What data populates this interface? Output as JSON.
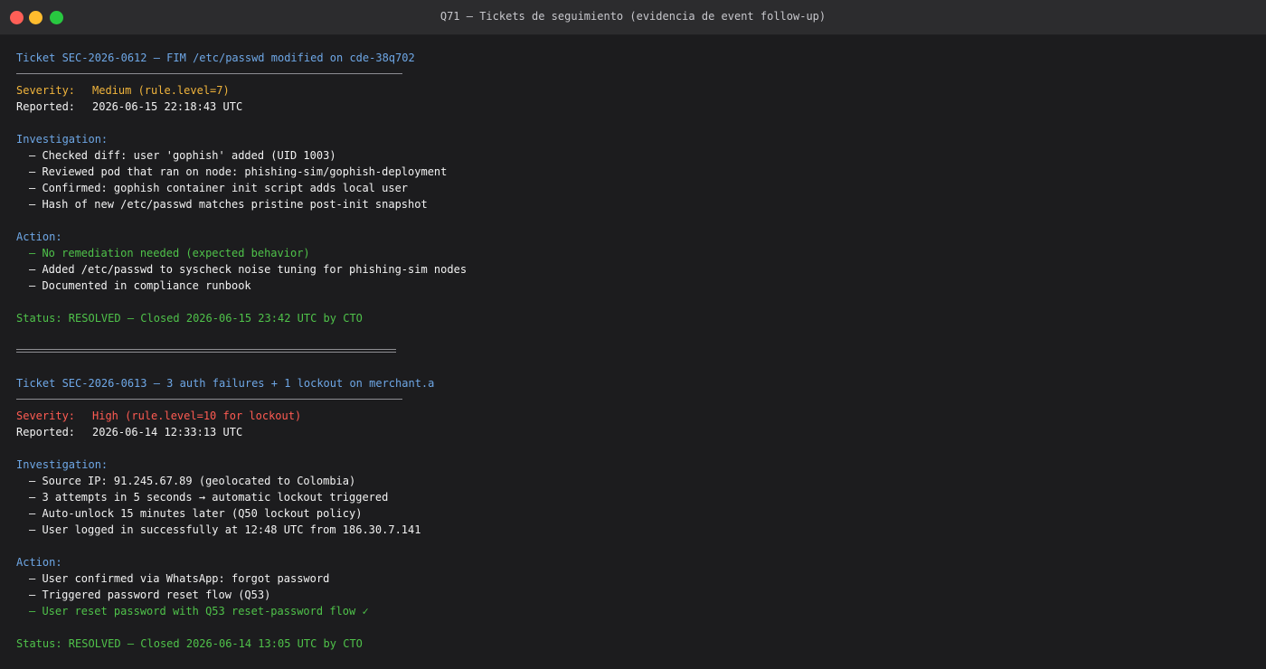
{
  "window": {
    "title": "Q71 — Tickets de seguimiento (evidencia de event follow-up)"
  },
  "colors": {
    "background": "#1c1c1e",
    "titlebar": "#2c2c2e",
    "heading_blue": "#6ea7e6",
    "severity_medium": "#f0b43c",
    "severity_high": "#ff5b52",
    "success_green": "#4fc24a",
    "text": "#f2f2f2"
  },
  "tickets": [
    {
      "header": "Ticket SEC-2026-0612 — FIM /etc/passwd modified on cde-38q702",
      "severity_label": "Severity:",
      "severity_value": "Medium (rule.level=7)",
      "reported_label": "Reported:",
      "reported_value": "2026-06-15 22:18:43 UTC",
      "investigation_label": "Investigation:",
      "investigation": [
        "– Checked diff: user 'gophish' added (UID 1003)",
        "– Reviewed pod that ran on node: phishing-sim/gophish-deployment",
        "– Confirmed: gophish container init script adds local user",
        "– Hash of new /etc/passwd matches pristine post-init snapshot"
      ],
      "action_label": "Action:",
      "actions": [
        "– No remediation needed (expected behavior)",
        "– Added /etc/passwd to syscheck noise tuning for phishing-sim nodes",
        "– Documented in compliance runbook"
      ],
      "status": "Status: RESOLVED — Closed 2026-06-15 23:42 UTC by CTO"
    },
    {
      "header": "Ticket SEC-2026-0613 — 3 auth failures + 1 lockout on merchant.a",
      "severity_label": "Severity:",
      "severity_value": "High (rule.level=10 for lockout)",
      "reported_label": "Reported:",
      "reported_value": "2026-06-14 12:33:13 UTC",
      "investigation_label": "Investigation:",
      "investigation": [
        "– Source IP: 91.245.67.89 (geolocated to Colombia)",
        "– 3 attempts in 5 seconds → automatic lockout triggered",
        "– Auto-unlock 15 minutes later (Q50 lockout policy)",
        "– User logged in successfully at 12:48 UTC from 186.30.7.141"
      ],
      "action_label": "Action:",
      "actions": [
        "– User confirmed via WhatsApp: forgot password",
        "– Triggered password reset flow (Q53)",
        "– User reset password with Q53 reset-password flow ✓"
      ],
      "status": "Status: RESOLVED — Closed 2026-06-14 13:05 UTC by CTO"
    }
  ]
}
